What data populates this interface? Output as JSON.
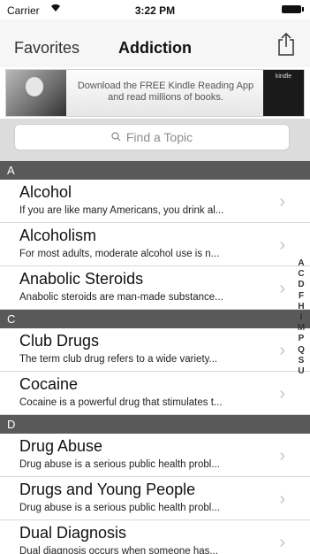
{
  "status": {
    "carrier": "Carrier",
    "time": "3:22 PM"
  },
  "nav": {
    "back": "Favorites",
    "title": "Addiction"
  },
  "ad": {
    "line1": "Download the FREE Kindle Reading App",
    "line2": "and read millions of books.",
    "device_label": "kindle"
  },
  "search": {
    "placeholder": "Find a Topic"
  },
  "sections": [
    {
      "letter": "A",
      "items": [
        {
          "title": "Alcohol",
          "subtitle": "If you are like many Americans, you drink al..."
        },
        {
          "title": "Alcoholism",
          "subtitle": "For most adults, moderate alcohol use is n..."
        },
        {
          "title": "Anabolic Steroids",
          "subtitle": "Anabolic steroids are man-made substance..."
        }
      ]
    },
    {
      "letter": "C",
      "items": [
        {
          "title": "Club Drugs",
          "subtitle": "The term club drug refers to a wide variety..."
        },
        {
          "title": "Cocaine",
          "subtitle": "Cocaine is a powerful drug that stimulates t..."
        }
      ]
    },
    {
      "letter": "D",
      "items": [
        {
          "title": "Drug Abuse",
          "subtitle": "Drug abuse is a serious public health probl..."
        },
        {
          "title": "Drugs and Young People",
          "subtitle": "Drug abuse is a serious public health probl..."
        },
        {
          "title": "Dual Diagnosis",
          "subtitle": "Dual diagnosis occurs when someone has..."
        }
      ]
    }
  ],
  "index_letters": [
    "A",
    "C",
    "D",
    "F",
    "H",
    "I",
    "M",
    "P",
    "Q",
    "S",
    "U"
  ]
}
